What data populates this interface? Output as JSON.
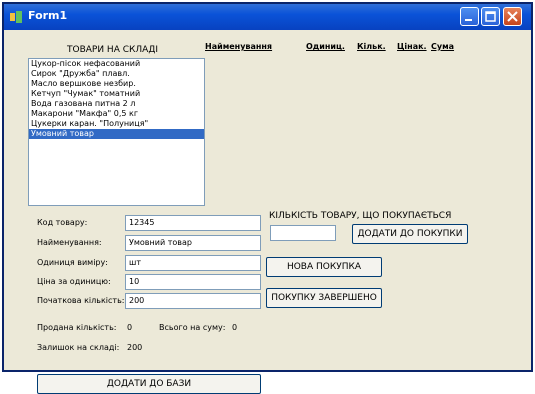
{
  "window": {
    "title": "Form1"
  },
  "stock": {
    "title": "ТОВАРИ НА СКЛАДІ",
    "items": [
      "Цукор-пісок нефасований",
      "Сирок \"Дружба\" плавл.",
      "Масло вершкове незбир.",
      "Кетчуп \"Чумак\" томатний",
      "Вода газована питна 2 л",
      "Макарони \"Макфа\" 0,5 кг",
      "Цукерки каран. \"Полуниця\"",
      "Умовний товар"
    ],
    "selected_index": 7
  },
  "purchase_columns": [
    "Найменування",
    "Одиниц.",
    "Кільк.",
    "Цінак.",
    "Сума"
  ],
  "form": {
    "code_label": "Код товару:",
    "code_value": "12345",
    "name_label": "Найменування:",
    "name_value": "Умовний товар",
    "unit_label": "Одиниця виміру:",
    "unit_value": "шт",
    "price_label": "Ціна за одиницю:",
    "price_value": "10",
    "qty_label": "Початкова кількість:",
    "qty_value": "200"
  },
  "stats": {
    "sold_label": "Продана кількість:",
    "sold_value": "0",
    "total_label": "Всього на суму:",
    "total_value": "0",
    "remain_label": "Залишок на складі:",
    "remain_value": "200"
  },
  "purchase": {
    "qty_label": "КІЛЬКІСТЬ ТОВАРУ, ЩО ПОКУПАЄТЬСЯ",
    "qty_value": "",
    "add_to_purchase": "ДОДАТИ ДО ПОКУПКИ",
    "new_purchase": "НОВА ПОКУПКА",
    "purchase_done": "ПОКУПКУ ЗАВЕРШЕНО"
  },
  "add_to_db": "ДОДАТИ ДО БАЗИ"
}
